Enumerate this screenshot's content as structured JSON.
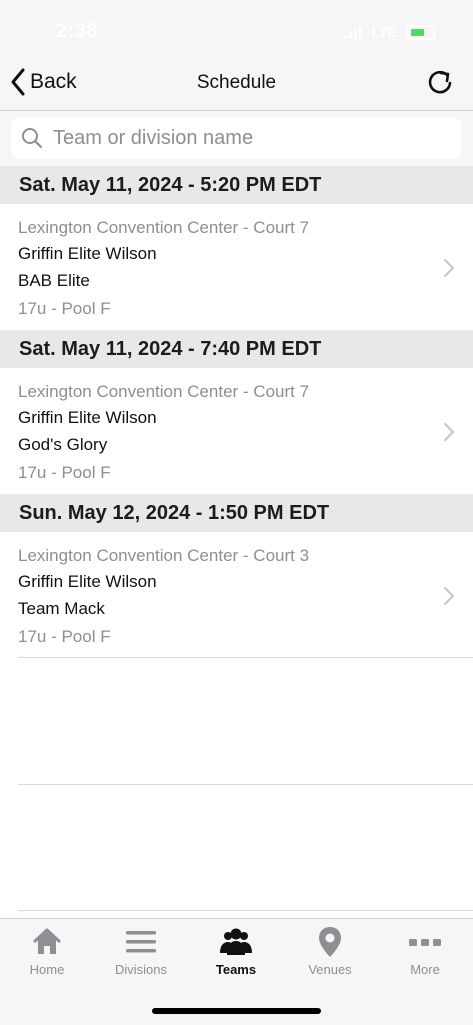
{
  "status_bar": {
    "time": "2:38",
    "network": "LTE"
  },
  "navbar": {
    "back_label": "Back",
    "title": "Schedule"
  },
  "search": {
    "placeholder": "Team or division name",
    "value": ""
  },
  "games": [
    {
      "date_header": "Sat. May 11, 2024 - 5:20 PM EDT",
      "venue": "Lexington Convention Center - Court 7",
      "team1": "Griffin Elite Wilson",
      "team2": "BAB Elite",
      "division": "17u - Pool F"
    },
    {
      "date_header": "Sat. May 11, 2024 - 7:40 PM EDT",
      "venue": "Lexington Convention Center - Court 7",
      "team1": "Griffin Elite Wilson",
      "team2": "God's Glory",
      "division": "17u - Pool F"
    },
    {
      "date_header": "Sun. May 12, 2024 - 1:50 PM EDT",
      "venue": "Lexington Convention Center - Court 3",
      "team1": "Griffin Elite Wilson",
      "team2": "Team Mack",
      "division": "17u - Pool F"
    }
  ],
  "tabbar": {
    "active": "Teams",
    "tabs": [
      {
        "label": "Home",
        "icon": "home-icon"
      },
      {
        "label": "Divisions",
        "icon": "list-icon"
      },
      {
        "label": "Teams",
        "icon": "team-icon"
      },
      {
        "label": "Venues",
        "icon": "map-pin-icon"
      },
      {
        "label": "More",
        "icon": "more-icon"
      }
    ]
  },
  "colors": {
    "accent_battery": "#4cd964",
    "inactive_tab": "#8e8e93",
    "section_bg": "#e8e8e8"
  }
}
